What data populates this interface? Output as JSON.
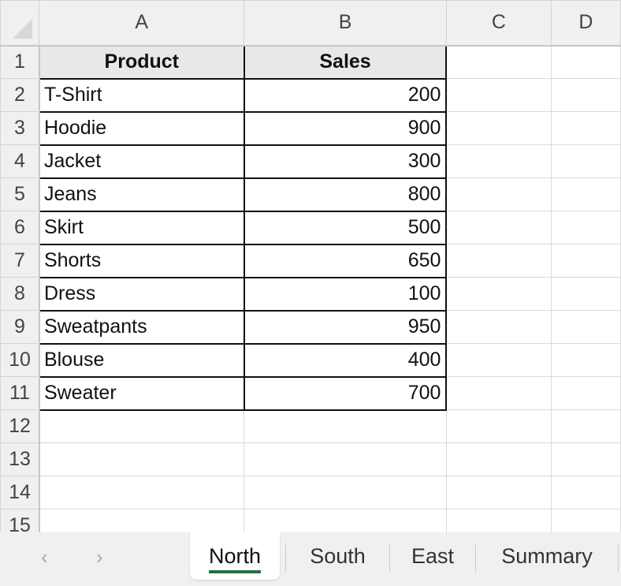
{
  "columns": [
    "A",
    "B",
    "C",
    "D"
  ],
  "rows": [
    "1",
    "2",
    "3",
    "4",
    "5",
    "6",
    "7",
    "8",
    "9",
    "10",
    "11",
    "12",
    "13",
    "14",
    "15"
  ],
  "table": {
    "headers": [
      "Product",
      "Sales"
    ],
    "data": [
      [
        "T-Shirt",
        "200"
      ],
      [
        "Hoodie",
        "900"
      ],
      [
        "Jacket",
        "300"
      ],
      [
        "Jeans",
        "800"
      ],
      [
        "Skirt",
        "500"
      ],
      [
        "Shorts",
        "650"
      ],
      [
        "Dress",
        "100"
      ],
      [
        "Sweatpants",
        "950"
      ],
      [
        "Blouse",
        "400"
      ],
      [
        "Sweater",
        "700"
      ]
    ]
  },
  "sheet_tabs": [
    {
      "label": "North",
      "active": true
    },
    {
      "label": "South",
      "active": false
    },
    {
      "label": "East",
      "active": false
    },
    {
      "label": "Summary",
      "active": false
    }
  ],
  "nav": {
    "prev": "‹",
    "next": "›"
  },
  "colors": {
    "accent": "#1e7145"
  }
}
